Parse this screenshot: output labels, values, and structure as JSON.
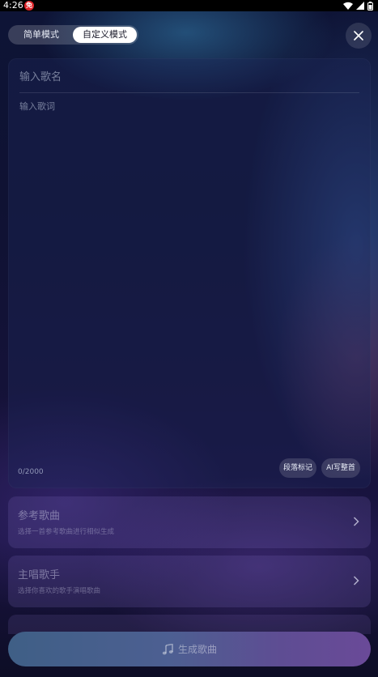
{
  "status_bar": {
    "time": "4:26",
    "notification_badge": "免"
  },
  "mode_toggle": {
    "simple": "简单模式",
    "custom": "自定义模式",
    "selected": "custom"
  },
  "close": {
    "icon": "close-icon"
  },
  "lyrics_card": {
    "song_name_placeholder": "输入歌名",
    "lyrics_placeholder": "输入歌词",
    "char_count": "0/2000",
    "section_mark": "段落标记",
    "ai_write": "AI写整首"
  },
  "reference_song": {
    "title": "参考歌曲",
    "subtitle": "选择一首参考歌曲进行相似生成"
  },
  "lead_singer": {
    "title": "主唱歌手",
    "subtitle": "选择你喜欢的歌手演唱歌曲"
  },
  "generate": {
    "label": "生成歌曲",
    "icon": "music-note-icon"
  },
  "colors": {
    "accent_start": "#3f5f86",
    "accent_end": "#6a4a98",
    "toggle_selected_bg": "#ffffff"
  }
}
